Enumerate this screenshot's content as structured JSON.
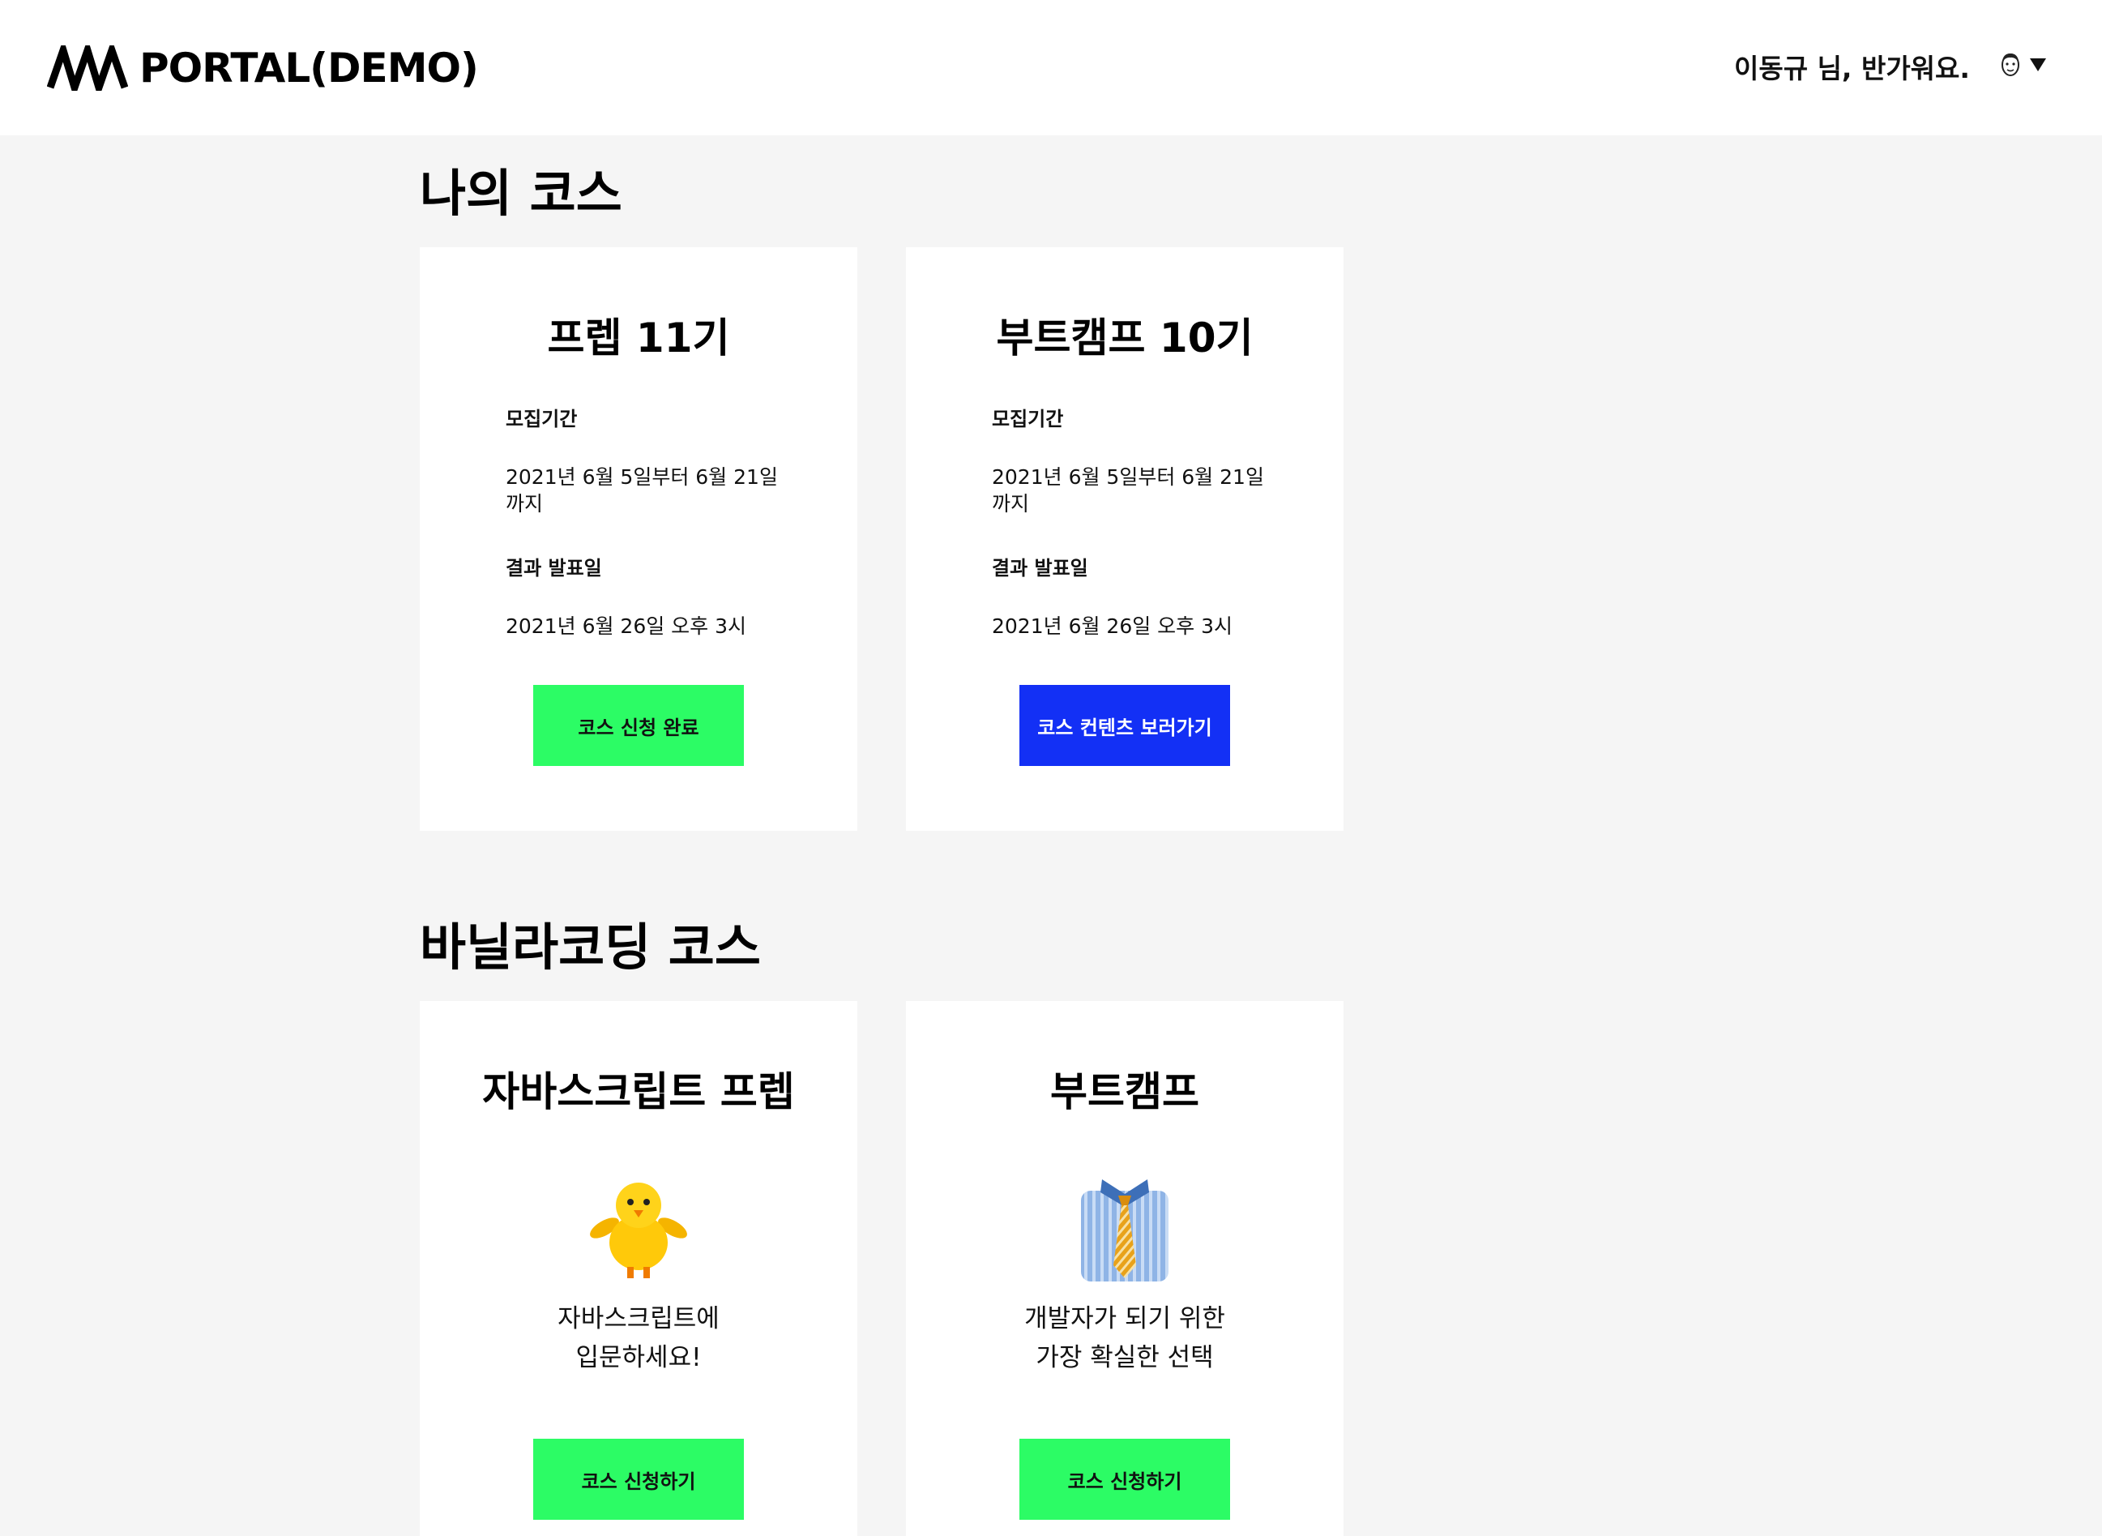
{
  "header": {
    "logo_text": "PORTAL(DEMO)",
    "greeting": "이동규 님, 반가워요."
  },
  "my_courses": {
    "title": "나의 코스",
    "cards": [
      {
        "title": "프렙 11기",
        "recruit_label": "모집기간",
        "recruit_line1": "2021년 6월 5일부터 6월 21일",
        "recruit_line2": "까지",
        "result_label": "결과 발표일",
        "result_value": "2021년 6월 26일 오후 3시",
        "button": "코스 신청 완료"
      },
      {
        "title": "부트캠프 10기",
        "recruit_label": "모집기간",
        "recruit_line1": "2021년 6월 5일부터 6월 21일",
        "recruit_line2": "까지",
        "result_label": "결과 발표일",
        "result_value": "2021년 6월 26일 오후 3시",
        "button": "코스 컨텐츠 보러가기"
      }
    ]
  },
  "vanilla_courses": {
    "title": "바닐라코딩 코스",
    "cards": [
      {
        "title": "자바스크립트 프렙",
        "icon": "chick-icon",
        "desc_line1": "자바스크립트에",
        "desc_line2": "입문하세요!",
        "button": "코스 신청하기"
      },
      {
        "title": "부트캠프",
        "icon": "shirt-tie-icon",
        "desc_line1": "개발자가 되기 위한",
        "desc_line2": "가장 확실한 선택",
        "button": "코스 신청하기"
      }
    ]
  },
  "colors": {
    "background": "#f5f5f5",
    "card": "#ffffff",
    "green_button": "#2cfc65",
    "blue_button": "#1330f5"
  }
}
